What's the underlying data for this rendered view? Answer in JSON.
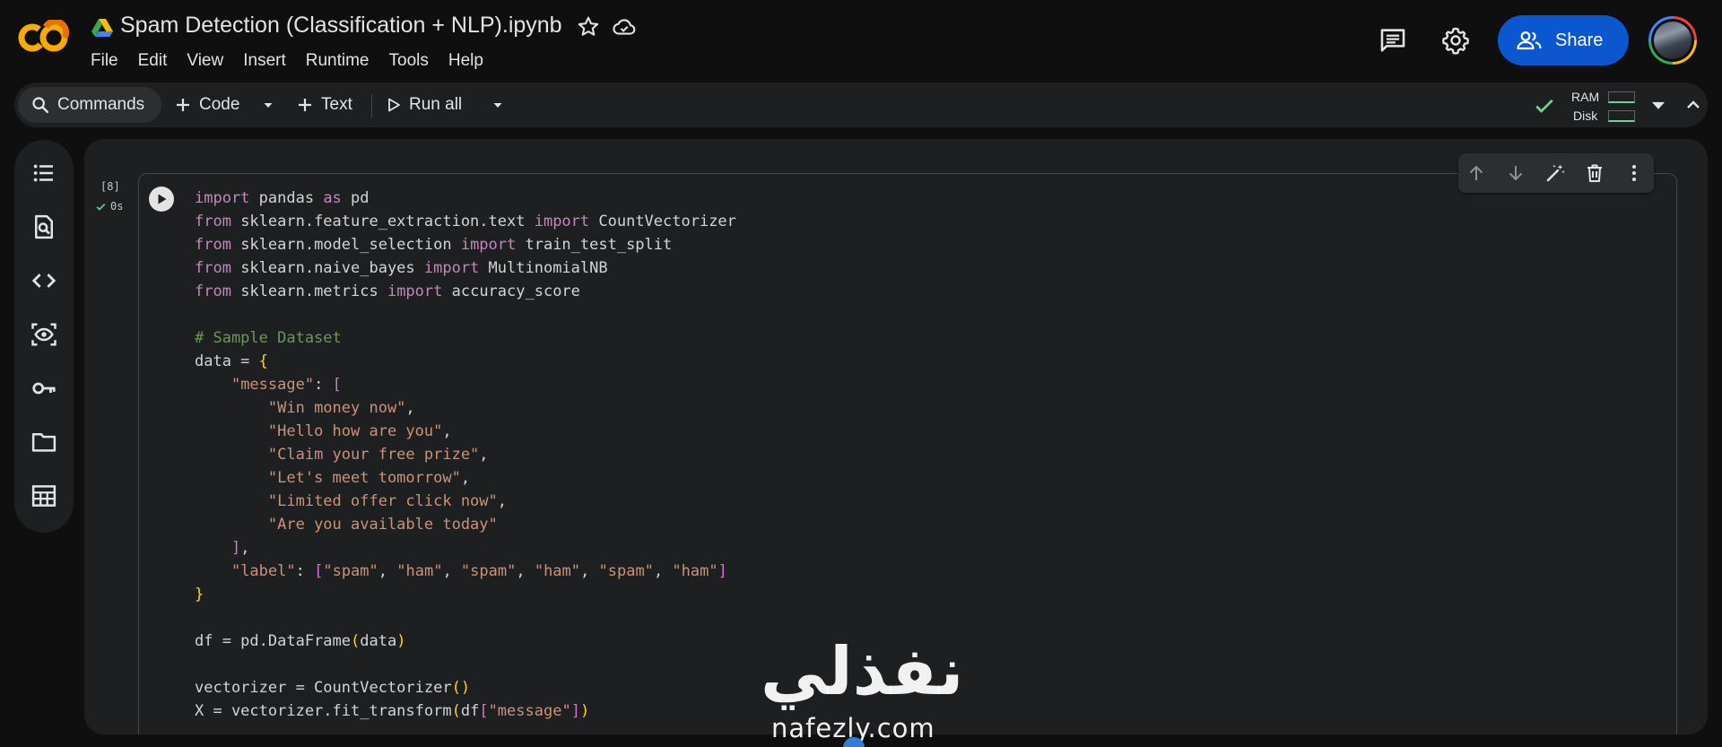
{
  "app": {
    "logo_text": "CO",
    "title": "Spam Detection (Classification + NLP).ipynb",
    "menu": [
      "File",
      "Edit",
      "View",
      "Insert",
      "Runtime",
      "Tools",
      "Help"
    ],
    "share_label": "Share"
  },
  "toolbar": {
    "commands_label": "Commands",
    "code_label": "Code",
    "text_label": "Text",
    "run_all_label": "Run all",
    "ram_label": "RAM",
    "disk_label": "Disk"
  },
  "cell": {
    "exec_count": "[8]",
    "exec_time": "0s"
  },
  "code_lines": [
    [
      {
        "t": "import",
        "c": "kw"
      },
      {
        "t": " pandas "
      },
      {
        "t": "as",
        "c": "kw"
      },
      {
        "t": " pd"
      }
    ],
    [
      {
        "t": "from",
        "c": "kw"
      },
      {
        "t": " sklearn.feature_extraction.text "
      },
      {
        "t": "import",
        "c": "kw"
      },
      {
        "t": " CountVectorizer"
      }
    ],
    [
      {
        "t": "from",
        "c": "kw"
      },
      {
        "t": " sklearn.model_selection "
      },
      {
        "t": "import",
        "c": "kw"
      },
      {
        "t": " train_test_split"
      }
    ],
    [
      {
        "t": "from",
        "c": "kw"
      },
      {
        "t": " sklearn.naive_bayes "
      },
      {
        "t": "import",
        "c": "kw"
      },
      {
        "t": " MultinomialNB"
      }
    ],
    [
      {
        "t": "from",
        "c": "kw"
      },
      {
        "t": " sklearn.metrics "
      },
      {
        "t": "import",
        "c": "kw"
      },
      {
        "t": " accuracy_score"
      }
    ],
    [],
    [
      {
        "t": "# Sample Dataset",
        "c": "com"
      }
    ],
    [
      {
        "t": "data = "
      },
      {
        "t": "{",
        "c": "br"
      }
    ],
    [
      {
        "t": "    "
      },
      {
        "t": "\"message\"",
        "c": "str"
      },
      {
        "t": ": "
      },
      {
        "t": "[",
        "c": "br2"
      }
    ],
    [
      {
        "t": "        "
      },
      {
        "t": "\"Win money now\"",
        "c": "str"
      },
      {
        "t": ","
      }
    ],
    [
      {
        "t": "        "
      },
      {
        "t": "\"Hello how are you\"",
        "c": "str"
      },
      {
        "t": ","
      }
    ],
    [
      {
        "t": "        "
      },
      {
        "t": "\"Claim your free prize\"",
        "c": "str"
      },
      {
        "t": ","
      }
    ],
    [
      {
        "t": "        "
      },
      {
        "t": "\"Let's meet tomorrow\"",
        "c": "str"
      },
      {
        "t": ","
      }
    ],
    [
      {
        "t": "        "
      },
      {
        "t": "\"Limited offer click now\"",
        "c": "str"
      },
      {
        "t": ","
      }
    ],
    [
      {
        "t": "        "
      },
      {
        "t": "\"Are you available today\"",
        "c": "str"
      }
    ],
    [
      {
        "t": "    "
      },
      {
        "t": "]",
        "c": "br2"
      },
      {
        "t": ","
      }
    ],
    [
      {
        "t": "    "
      },
      {
        "t": "\"label\"",
        "c": "str"
      },
      {
        "t": ": "
      },
      {
        "t": "[",
        "c": "br2"
      },
      {
        "t": "\"spam\"",
        "c": "str"
      },
      {
        "t": ", "
      },
      {
        "t": "\"ham\"",
        "c": "str"
      },
      {
        "t": ", "
      },
      {
        "t": "\"spam\"",
        "c": "str"
      },
      {
        "t": ", "
      },
      {
        "t": "\"ham\"",
        "c": "str"
      },
      {
        "t": ", "
      },
      {
        "t": "\"spam\"",
        "c": "str"
      },
      {
        "t": ", "
      },
      {
        "t": "\"ham\"",
        "c": "str"
      },
      {
        "t": "]",
        "c": "br2"
      }
    ],
    [
      {
        "t": "}",
        "c": "br"
      }
    ],
    [],
    [
      {
        "t": "df = pd.DataFrame"
      },
      {
        "t": "(",
        "c": "br"
      },
      {
        "t": "data"
      },
      {
        "t": ")",
        "c": "br"
      }
    ],
    [],
    [
      {
        "t": "vectorizer = CountVectorizer"
      },
      {
        "t": "()",
        "c": "br"
      }
    ],
    [
      {
        "t": "X = vectorizer.fit_transform"
      },
      {
        "t": "(",
        "c": "br"
      },
      {
        "t": "df"
      },
      {
        "t": "[",
        "c": "br2"
      },
      {
        "t": "\"message\"",
        "c": "str"
      },
      {
        "t": "]",
        "c": "br2"
      },
      {
        "t": ")",
        "c": "br"
      }
    ]
  ],
  "watermark": {
    "arabic": "نفذلي",
    "latin": "nafezly.com"
  },
  "colors": {
    "accent_orange": "#f9ab00",
    "accent_orange_dark": "#e37400",
    "share_blue": "#0b57d0",
    "status_green": "#6dd58c",
    "keyword": "#c586c0",
    "string": "#ce9178",
    "comment": "#6a9955"
  },
  "icons": {
    "rail": [
      "toc-icon",
      "find-icon",
      "code-snippets-icon",
      "variables-icon",
      "secrets-key-icon",
      "folder-icon",
      "data-table-icon"
    ],
    "cell_toolbar": [
      "arrow-up-icon",
      "arrow-down-icon",
      "magic-edit-icon",
      "trash-icon",
      "more-vert-icon"
    ]
  }
}
